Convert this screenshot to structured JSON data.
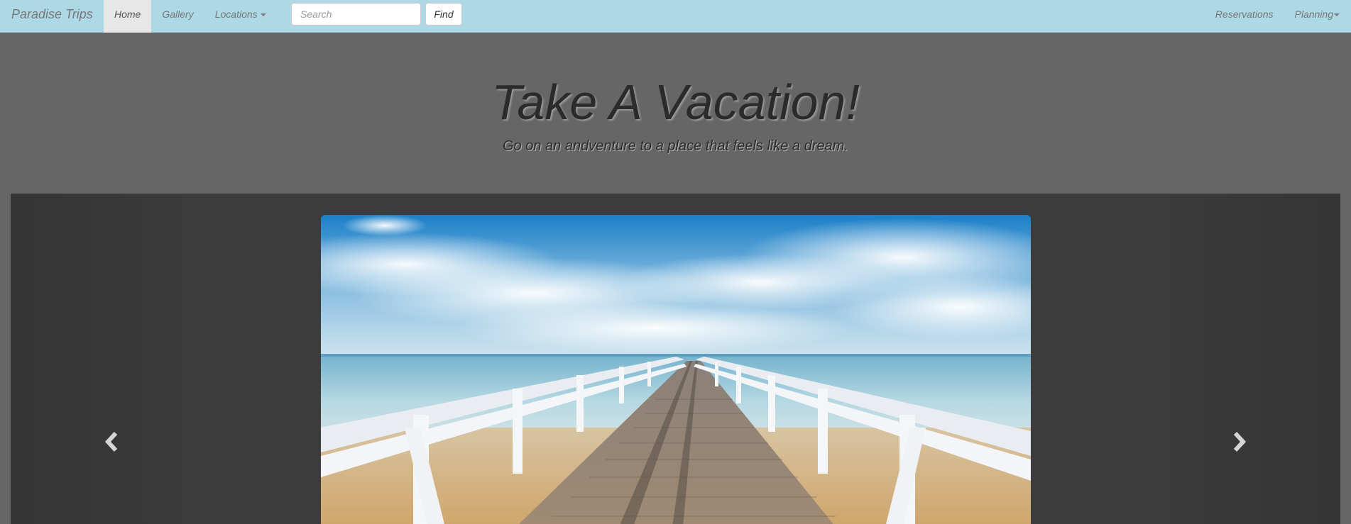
{
  "navbar": {
    "brand": "Paradise Trips",
    "items": [
      {
        "label": "Home",
        "active": true
      },
      {
        "label": "Gallery",
        "active": false
      },
      {
        "label": "Locations",
        "active": false,
        "dropdown": true
      }
    ],
    "search": {
      "placeholder": "Search",
      "value": ""
    },
    "find_label": "Find",
    "right_items": [
      {
        "label": "Reservations",
        "dropdown": false
      },
      {
        "label": "Planning",
        "dropdown": true
      }
    ]
  },
  "hero": {
    "title": "Take A Vacation!",
    "subtitle": "Go on an andventure to a place that feels like a dream."
  },
  "carousel": {
    "prev_icon": "chevron-left-icon",
    "next_icon": "chevron-right-icon",
    "slide_image": "beach pier photo"
  },
  "colors": {
    "navbar_bg": "#add8e6",
    "active_tab_bg": "#e7e7e7",
    "page_bg": "#666666",
    "carousel_bg": "#3c3c3c"
  }
}
